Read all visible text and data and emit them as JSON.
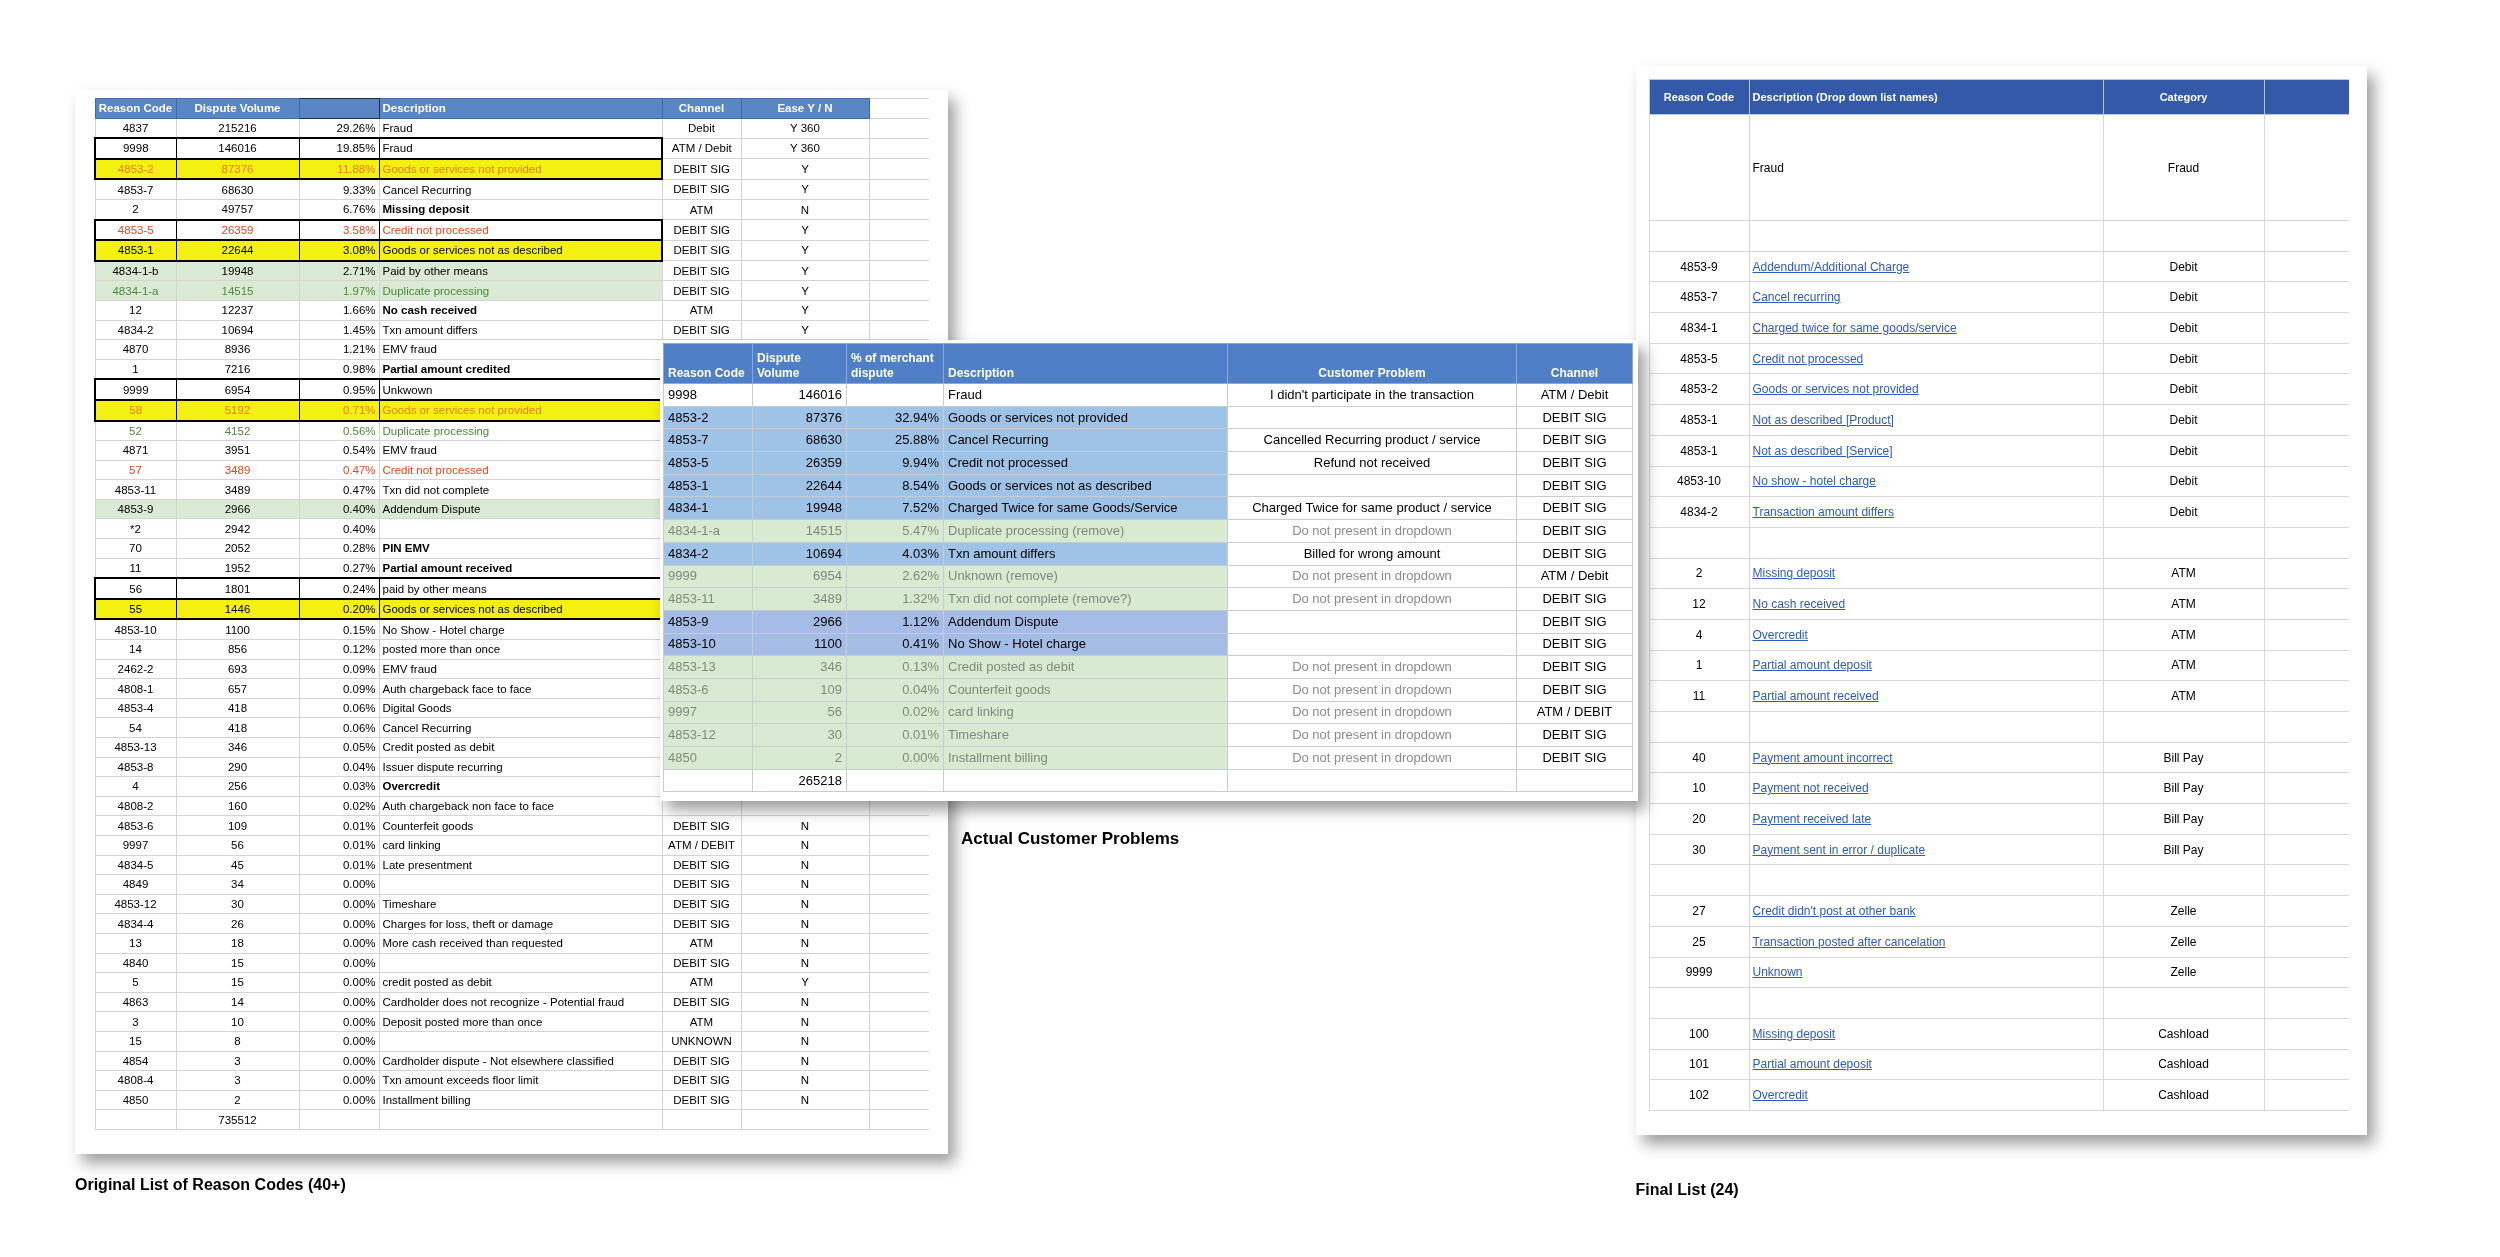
{
  "original_list": {
    "columns": [
      "Reason Code",
      "Dispute Volume",
      "Description",
      "Channel",
      "Ease Y / N"
    ],
    "rows": [
      {
        "code": "4837",
        "volume": "215216",
        "pct": "29.26%",
        "description": "Fraud",
        "channel": "Debit",
        "ease": "Y 360"
      },
      {
        "code": "9998",
        "volume": "146016",
        "pct": "19.85%",
        "description": "Fraud",
        "channel": "ATM / Debit",
        "ease": "Y 360",
        "boxed": true
      },
      {
        "code": "4853-2",
        "volume": "87376",
        "pct": "11.88%",
        "description": "Goods or services not provided",
        "channel": "DEBIT SIG",
        "ease": "Y",
        "color": "#f4f00f",
        "ink": {
          "color": "#e8801a"
        },
        "boxed": true
      },
      {
        "code": "4853-7",
        "volume": "68630",
        "pct": "9.33%",
        "description": "Cancel Recurring",
        "channel": "DEBIT SIG",
        "ease": "Y"
      },
      {
        "code": "2",
        "volume": "49757",
        "pct": "6.76%",
        "description": "Missing deposit",
        "channel": "ATM",
        "ease": "N",
        "bold": true
      },
      {
        "code": "4853-5",
        "volume": "26359",
        "pct": "3.58%",
        "description": "Credit not processed",
        "channel": "DEBIT SIG",
        "ease": "Y",
        "ink": {
          "color": "#e2471f"
        },
        "boxed": true
      },
      {
        "code": "4853-1",
        "volume": "22644",
        "pct": "3.08%",
        "description": "Goods or services not as described",
        "channel": "DEBIT SIG",
        "ease": "Y",
        "color": "#f4f00f",
        "boxed": true
      },
      {
        "code": "4834-1-b",
        "volume": "19948",
        "pct": "2.71%",
        "description": "Paid by other means",
        "channel": "DEBIT SIG",
        "ease": "Y",
        "color": "#dbead5"
      },
      {
        "code": "4834-1-a",
        "volume": "14515",
        "pct": "1.97%",
        "description": "Duplicate processing",
        "channel": "DEBIT SIG",
        "ease": "Y",
        "color": "#dbead5",
        "ink": {
          "color": "#4c8a3a"
        }
      },
      {
        "code": "12",
        "volume": "12237",
        "pct": "1.66%",
        "description": "No cash received",
        "channel": "ATM",
        "ease": "Y",
        "bold": true
      },
      {
        "code": "4834-2",
        "volume": "10694",
        "pct": "1.45%",
        "description": "Txn amount differs",
        "channel": "DEBIT SIG",
        "ease": "Y"
      },
      {
        "code": "4870",
        "volume": "8936",
        "pct": "1.21%",
        "description": "EMV fraud"
      },
      {
        "code": "1",
        "volume": "7216",
        "pct": "0.98%",
        "description": "Partial amount credited",
        "bold": true
      },
      {
        "code": "9999",
        "volume": "6954",
        "pct": "0.95%",
        "description": "Unkwown",
        "boxed": true
      },
      {
        "code": "58",
        "volume": "5192",
        "pct": "0.71%",
        "description": "Goods or services not provided",
        "color": "#f4f00f",
        "ink": {
          "color": "#e8801a"
        },
        "boxed": true
      },
      {
        "code": "52",
        "volume": "4152",
        "pct": "0.56%",
        "description": "Duplicate processing",
        "ink": {
          "color": "#4c8a3a"
        }
      },
      {
        "code": "4871",
        "volume": "3951",
        "pct": "0.54%",
        "description": "EMV fraud"
      },
      {
        "code": "57",
        "volume": "3489",
        "pct": "0.47%",
        "description": "Credit not processed",
        "ink": {
          "color": "#e2471f"
        }
      },
      {
        "code": "4853-11",
        "volume": "3489",
        "pct": "0.47%",
        "description": "Txn did not complete"
      },
      {
        "code": "4853-9",
        "volume": "2966",
        "pct": "0.40%",
        "description": "Addendum Dispute",
        "color": "#dbead5"
      },
      {
        "code": "*2",
        "volume": "2942",
        "pct": "0.40%"
      },
      {
        "code": "70",
        "volume": "2052",
        "pct": "0.28%",
        "description": "PIN EMV",
        "bold": true
      },
      {
        "code": "11",
        "volume": "1952",
        "pct": "0.27%",
        "description": "Partial amount received",
        "bold": true
      },
      {
        "code": "56",
        "volume": "1801",
        "pct": "0.24%",
        "description": "paid by other means",
        "boxed": true
      },
      {
        "code": "55",
        "volume": "1446",
        "pct": "0.20%",
        "description": "Goods or services not as described",
        "color": "#f4f00f",
        "boxed": true
      },
      {
        "code": "4853-10",
        "volume": "1100",
        "pct": "0.15%",
        "description": "No Show - Hotel charge"
      },
      {
        "code": "14",
        "volume": "856",
        "pct": "0.12%",
        "description": "posted more than once"
      },
      {
        "code": "2462-2",
        "volume": "693",
        "pct": "0.09%",
        "description": "EMV fraud"
      },
      {
        "code": "4808-1",
        "volume": "657",
        "pct": "0.09%",
        "description": "Auth chargeback face to face"
      },
      {
        "code": "4853-4",
        "volume": "418",
        "pct": "0.06%",
        "description": "Digital Goods"
      },
      {
        "code": "54",
        "volume": "418",
        "pct": "0.06%",
        "description": "Cancel Recurring"
      },
      {
        "code": "4853-13",
        "volume": "346",
        "pct": "0.05%",
        "description": "Credit posted as debit"
      },
      {
        "code": "4853-8",
        "volume": "290",
        "pct": "0.04%",
        "description": "Issuer dispute recurring"
      },
      {
        "code": "4",
        "volume": "256",
        "pct": "0.03%",
        "description": "Overcredit",
        "bold": true
      },
      {
        "code": "4808-2",
        "volume": "160",
        "pct": "0.02%",
        "description": "Auth chargeback non face to face"
      },
      {
        "code": "4853-6",
        "volume": "109",
        "pct": "0.01%",
        "description": "Counterfeit goods",
        "channel": "DEBIT SIG",
        "ease": "N"
      },
      {
        "code": "9997",
        "volume": "56",
        "pct": "0.01%",
        "description": "card linking",
        "channel": "ATM / DEBIT",
        "ease": "N"
      },
      {
        "code": "4834-5",
        "volume": "45",
        "pct": "0.01%",
        "description": "Late presentment",
        "channel": "DEBIT SIG",
        "ease": "N"
      },
      {
        "code": "4849",
        "volume": "34",
        "pct": "0.00%",
        "channel": "DEBIT SIG",
        "ease": "N"
      },
      {
        "code": "4853-12",
        "volume": "30",
        "pct": "0.00%",
        "description": "Timeshare",
        "channel": "DEBIT SIG",
        "ease": "N"
      },
      {
        "code": "4834-4",
        "volume": "26",
        "pct": "0.00%",
        "description": "Charges for loss, theft or damage",
        "channel": "DEBIT SIG",
        "ease": "N"
      },
      {
        "code": "13",
        "volume": "18",
        "pct": "0.00%",
        "description": "More cash received than requested",
        "channel": "ATM",
        "ease": "N"
      },
      {
        "code": "4840",
        "volume": "15",
        "pct": "0.00%",
        "channel": "DEBIT SIG",
        "ease": "N"
      },
      {
        "code": "5",
        "volume": "15",
        "pct": "0.00%",
        "description": "credit posted as debit",
        "channel": "ATM",
        "ease": "Y"
      },
      {
        "code": "4863",
        "volume": "14",
        "pct": "0.00%",
        "description": "Cardholder does not recognize - Potential fraud",
        "channel": "DEBIT SIG",
        "ease": "N"
      },
      {
        "code": "3",
        "volume": "10",
        "pct": "0.00%",
        "description": "Deposit posted more than once",
        "channel": "ATM",
        "ease": "N"
      },
      {
        "code": "15",
        "volume": "8",
        "pct": "0.00%",
        "channel": "UNKNOWN",
        "ease": "N"
      },
      {
        "code": "4854",
        "volume": "3",
        "pct": "0.00%",
        "description": "Cardholder dispute - Not elsewhere classified",
        "channel": "DEBIT SIG",
        "ease": "N"
      },
      {
        "code": "4808-4",
        "volume": "3",
        "pct": "0.00%",
        "description": "Txn amount exceeds floor limit",
        "channel": "DEBIT SIG",
        "ease": "N"
      },
      {
        "code": "4850",
        "volume": "2",
        "pct": "0.00%",
        "description": "Installment billing",
        "channel": "DEBIT SIG",
        "ease": "N"
      }
    ],
    "total_volume": "735512",
    "caption": "Original List of Reason Codes (40+)"
  },
  "customer_problems": {
    "columns": [
      "Reason Code",
      "Dispute Volume",
      "% of merchant dispute",
      "Description",
      "Customer Problem",
      "Channel"
    ],
    "rows": [
      {
        "code": "9998",
        "volume": "146016",
        "description": "Fraud",
        "problem": "I didn't participate in the transaction",
        "channel": "ATM / Debit",
        "kind": "plain"
      },
      {
        "code": "4853-2",
        "volume": "87376",
        "pct": "32.94%",
        "description": "Goods or services not provided",
        "channel": "DEBIT SIG",
        "kind": "kept"
      },
      {
        "code": "4853-7",
        "volume": "68630",
        "pct": "25.88%",
        "description": "Cancel Recurring",
        "problem": "Cancelled Recurring product / service",
        "channel": "DEBIT SIG",
        "kind": "kept"
      },
      {
        "code": "4853-5",
        "volume": "26359",
        "pct": "9.94%",
        "description": "Credit not processed",
        "problem": "Refund not received",
        "channel": "DEBIT SIG",
        "kind": "kept"
      },
      {
        "code": "4853-1",
        "volume": "22644",
        "pct": "8.54%",
        "description": "Goods or services not as described",
        "channel": "DEBIT SIG",
        "kind": "kept"
      },
      {
        "code": "4834-1",
        "volume": "19948",
        "pct": "7.52%",
        "description": "Charged Twice for same Goods/Service",
        "problem": "Charged Twice for same product / service",
        "channel": "DEBIT SIG",
        "kind": "kept"
      },
      {
        "code": "4834-1-a",
        "volume": "14515",
        "pct": "5.47%",
        "description": "Duplicate processing (remove)",
        "problem": "Do not present in dropdown",
        "channel": "DEBIT SIG",
        "kind": "removed"
      },
      {
        "code": "4834-2",
        "volume": "10694",
        "pct": "4.03%",
        "description": "Txn amount differs",
        "problem": "Billed for wrong amount",
        "channel": "DEBIT SIG",
        "kind": "kept"
      },
      {
        "code": "9999",
        "volume": "6954",
        "pct": "2.62%",
        "description": "Unknown (remove)",
        "problem": "Do not present in dropdown",
        "channel": "ATM / Debit",
        "kind": "removed"
      },
      {
        "code": "4853-11",
        "volume": "3489",
        "pct": "1.32%",
        "description": "Txn did not complete (remove?)",
        "problem": "Do not present in dropdown",
        "channel": "DEBIT SIG",
        "kind": "removed"
      },
      {
        "code": "4853-9",
        "volume": "2966",
        "pct": "1.12%",
        "description": "Addendum Dispute",
        "channel": "DEBIT SIG",
        "kind": "shaded"
      },
      {
        "code": "4853-10",
        "volume": "1100",
        "pct": "0.41%",
        "description": "No Show - Hotel charge",
        "channel": "DEBIT SIG",
        "kind": "shaded"
      },
      {
        "code": "4853-13",
        "volume": "346",
        "pct": "0.13%",
        "description": "Credit posted as debit",
        "problem": "Do not present in dropdown",
        "channel": "DEBIT SIG",
        "kind": "removed"
      },
      {
        "code": "4853-6",
        "volume": "109",
        "pct": "0.04%",
        "description": "Counterfeit goods",
        "problem": "Do not present in dropdown",
        "channel": "DEBIT SIG",
        "kind": "removed"
      },
      {
        "code": "9997",
        "volume": "56",
        "pct": "0.02%",
        "description": "card linking",
        "problem": "Do not present in dropdown",
        "channel": "ATM / DEBIT",
        "kind": "removed"
      },
      {
        "code": "4853-12",
        "volume": "30",
        "pct": "0.01%",
        "description": "Timeshare",
        "problem": "Do not present in dropdown",
        "channel": "DEBIT SIG",
        "kind": "removed"
      },
      {
        "code": "4850",
        "volume": "2",
        "pct": "0.00%",
        "description": "Installment billing",
        "problem": "Do not present in dropdown",
        "channel": "DEBIT SIG",
        "kind": "removed"
      }
    ],
    "total_volume": "265218",
    "caption": "Actual Customer Problems"
  },
  "final_list": {
    "columns": [
      "Reason Code",
      "Description (Drop down list names)",
      "Category"
    ],
    "groups": [
      {
        "rows": [
          {
            "kind": "merged",
            "description": "Fraud",
            "category": "Fraud",
            "link": false
          }
        ]
      },
      {
        "rows": [
          {
            "kind": "entry",
            "code": "4853-9",
            "description": "Addendum/Additional Charge",
            "category": "Debit",
            "link": true
          },
          {
            "kind": "entry",
            "code": "4853-7",
            "description": "Cancel recurring",
            "category": "Debit",
            "link": true
          },
          {
            "kind": "entry",
            "code": "4834-1",
            "description": "Charged twice for same goods/service",
            "category": "Debit",
            "link": true
          },
          {
            "kind": "entry",
            "code": "4853-5",
            "description": "Credit not processed",
            "category": "Debit",
            "link": true
          },
          {
            "kind": "entry",
            "code": "4853-2",
            "description": "Goods or services not provided",
            "category": "Debit",
            "link": true
          },
          {
            "kind": "entry",
            "code": "4853-1",
            "description": "Not as described [Product]",
            "category": "Debit",
            "link": true
          },
          {
            "kind": "entry",
            "code": "4853-1",
            "description": "Not as described [Service]",
            "category": "Debit",
            "link": true
          },
          {
            "kind": "entry",
            "code": "4853-10",
            "description": "No show - hotel charge",
            "category": "Debit",
            "link": true
          },
          {
            "kind": "entry",
            "code": "4834-2",
            "description": "Transaction amount differs",
            "category": "Debit",
            "link": true
          }
        ]
      },
      {
        "rows": [
          {
            "kind": "entry",
            "code": "2",
            "description": "Missing deposit",
            "category": "ATM",
            "link": true
          },
          {
            "kind": "entry",
            "code": "12",
            "description": "No cash received",
            "category": "ATM",
            "link": true
          },
          {
            "kind": "entry",
            "code": "4",
            "description": "Overcredit",
            "category": "ATM",
            "link": true
          },
          {
            "kind": "entry",
            "code": "1",
            "description": "Partial amount deposit",
            "category": "ATM",
            "link": true
          },
          {
            "kind": "entry",
            "code": "11",
            "description": "Partial amount received",
            "category": "ATM",
            "link": true
          }
        ]
      },
      {
        "rows": [
          {
            "kind": "entry",
            "code": "40",
            "description": "Payment amount incorrect",
            "category": "Bill Pay",
            "link": true
          },
          {
            "kind": "entry",
            "code": "10",
            "description": "Payment not received",
            "category": "Bill Pay",
            "link": true
          },
          {
            "kind": "entry",
            "code": "20",
            "description": "Payment received late",
            "category": "Bill Pay",
            "link": true
          },
          {
            "kind": "entry",
            "code": "30",
            "description": "Payment sent in error / duplicate",
            "category": "Bill Pay",
            "link": true
          }
        ]
      },
      {
        "rows": [
          {
            "kind": "entry",
            "code": "27",
            "description": "Credit didn't post at other bank",
            "category": "Zelle",
            "link": true
          },
          {
            "kind": "entry",
            "code": "25",
            "description": "Transaction posted after cancelation",
            "category": "Zelle",
            "link": true
          },
          {
            "kind": "entry",
            "code": "9999",
            "description": "Unknown",
            "category": "Zelle",
            "link": true
          }
        ]
      },
      {
        "rows": [
          {
            "kind": "entry",
            "code": "100",
            "description": "Missing deposit",
            "category": "Cashload",
            "link": true
          },
          {
            "kind": "entry",
            "code": "101",
            "description": "Partial amount deposit",
            "category": "Cashload",
            "link": true
          },
          {
            "kind": "entry",
            "code": "102",
            "description": "Overcredit",
            "category": "Cashload",
            "link": true
          }
        ]
      }
    ],
    "caption": "Final List (24)"
  }
}
